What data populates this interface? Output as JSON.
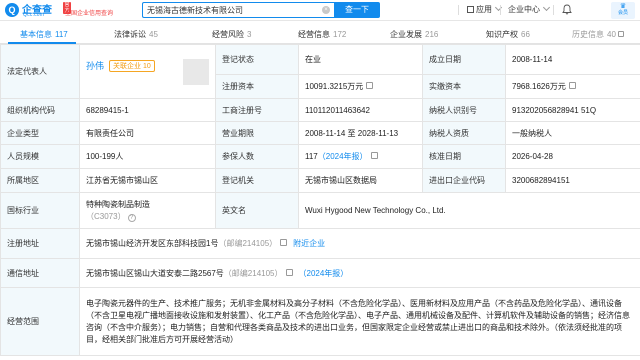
{
  "logo": {
    "name": "企查查",
    "url": "Qcc.com",
    "tag": "官方",
    "subtitle": "全国企业信用查询"
  },
  "search": {
    "value": "无锡海古德新技术有限公司",
    "button": "查一下"
  },
  "nav": {
    "app": "应用",
    "enterprise_center": "企业中心",
    "vip": "会员",
    "vip_sub": "优惠"
  },
  "tabs": [
    {
      "label": "基本信息",
      "count": "117"
    },
    {
      "label": "法律诉讼",
      "count": "45"
    },
    {
      "label": "经营风险",
      "count": "3"
    },
    {
      "label": "经营信息",
      "count": "172"
    },
    {
      "label": "企业发展",
      "count": "216"
    },
    {
      "label": "知识产权",
      "count": "66"
    },
    {
      "label": "历史信息",
      "count": "40"
    }
  ],
  "info": {
    "legal_rep_label": "法定代表人",
    "legal_rep": "孙伟",
    "related_tag": "关联企业",
    "related_count": "10",
    "reg_status_label": "登记状态",
    "reg_status": "在业",
    "est_date_label": "成立日期",
    "est_date": "2008-11-14",
    "reg_capital_label": "注册资本",
    "reg_capital": "10091.3215万元",
    "paid_capital_label": "实缴资本",
    "paid_capital": "7968.1626万元",
    "org_code_label": "组织机构代码",
    "org_code": "68289415-1",
    "biz_reg_no_label": "工商注册号",
    "biz_reg_no": "110112011463642",
    "taxpayer_id_label": "纳税人识别号",
    "taxpayer_id": "913202056828941 51Q",
    "company_type_label": "企业类型",
    "company_type": "有限责任公司",
    "biz_term_label": "营业期限",
    "biz_term": "2008-11-14 至 2028-11-13",
    "taxpayer_qual_label": "纳税人资质",
    "taxpayer_qual": "一般纳税人",
    "staff_size_label": "人员规模",
    "staff_size": "100-199人",
    "insured_label": "参保人数",
    "insured": "117",
    "insured_year": "（2024年报）",
    "approval_date_label": "核准日期",
    "approval_date": "2026-04-28",
    "region_label": "所属地区",
    "region": "江苏省无锡市锡山区",
    "reg_authority_label": "登记机关",
    "reg_authority": "无锡市锡山区数据局",
    "import_export_label": "进出口企业代码",
    "import_export": "3200682894151",
    "industry_label": "国标行业",
    "industry": "特种陶瓷制品制造",
    "industry_code": "（C3073）",
    "english_name_label": "英文名",
    "english_name": "Wuxi Hygood New Technology Co., Ltd.",
    "reg_address_label": "注册地址",
    "reg_address": "无锡市锡山经济开发区东部科技园1号",
    "reg_address_zip": "（邮编214105）",
    "reg_address_link": "附近企业",
    "mail_address_label": "通信地址",
    "mail_address": "无锡市锡山区锡山大道安泰二路2567号",
    "mail_address_zip": "（邮编214105）",
    "mail_address_year": "（2024年报）",
    "scope_label": "经营范围",
    "scope": "电子陶瓷元器件的生产、技术推广服务；无机非金属材料及高分子材料（不含危险化学品）、医用新材料及应用产品（不含药品及危险化学品）、通讯设备（不含卫星电视广播地面接收设施和发射装置）、化工产品（不含危险化学品）、电子产品、通用机械设备及配件、计算机软件及辅助设备的销售；经济信息咨询（不含中介服务）；电力销售；自营和代理各类商品及技术的进出口业务，但国家限定企业经营或禁止进出口的商品和技术除外。（依法须经批准的项目，经相关部门批准后方可开展经营活动）"
  },
  "colors": {
    "accent": "#128bed",
    "label_bg": "#f2f9fc",
    "tag_orange": "#f39c12",
    "brand_red": "#f04142"
  }
}
